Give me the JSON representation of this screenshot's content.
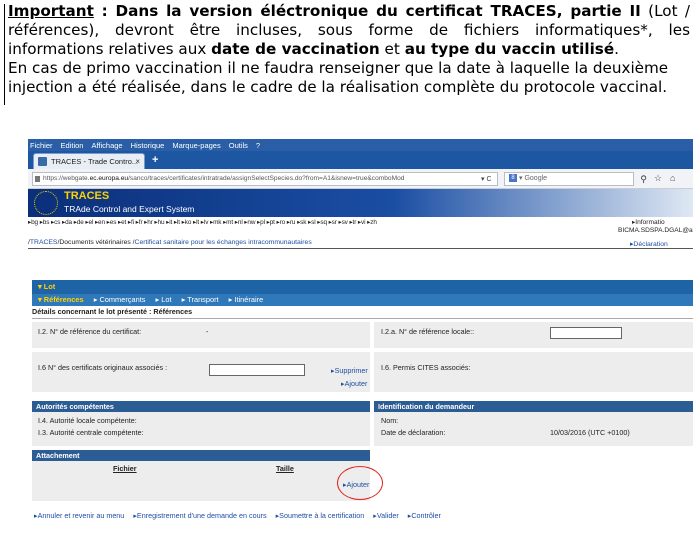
{
  "doc": {
    "important": "Important",
    "p1_bold": " : Dans la version éléctronique du certificat TRACES, partie II",
    "p1_text": " (Lot / références), devront être incluses, sous forme de fichiers informatiques*, les informations relatives aux ",
    "p1_bold2": "date de vaccination",
    "p1_text2": " et ",
    "p1_bold3": "au type du vaccin utilisé",
    "p1_end": ".",
    "p2": "En cas de primo vaccination il ne faudra renseigner que la date à laquelle la deuxième injection a été réalisée, dans le cadre de la réalisation complète du protocole vaccinal."
  },
  "browser": {
    "menu": [
      "Fichier",
      "Edition",
      "Affichage",
      "Historique",
      "Marque-pages",
      "Outils",
      "?"
    ],
    "tab_title": "TRACES - Trade Contro...",
    "url_prefix": "https://webgate.",
    "url_host": "ec.europa.eu",
    "url_rest": "/sanco/traces/certificates/intratrade/assignSelectSpecies.do?from=A1&isnew=true&comboMod",
    "search_placeholder": "Google"
  },
  "site": {
    "title": "TRACES",
    "subtitle": "TRAde Control and Expert System",
    "languages": "▸bg ▸bs ▸cs ▸da ▸de ▸el ▸en ▸es ▸et ▸fi ▸fr ▸hr ▸hu ▸it ▸lt ▸ko ▸lt ▸lv ▸mk ▸mt ▸nl ▸nw ▸pl ▸pt ▸ro ▸ru ▸sk ▸sl ▸sq ▸sr ▸sv ▸tr ▸vi ▸zh",
    "info": "▸Informatio",
    "user": "BICMA.SDSPA.DGAL@a",
    "breadcrumb_home": "TRACES",
    "breadcrumb_mid": "Documents vétérinaires",
    "breadcrumb_last": "Certificat sanitaire pour les échanges intracommunautaires",
    "declaration_link": "▸Déclaration"
  },
  "form": {
    "lot": "▾ Lot",
    "subnav": [
      "▾ Références",
      "▸ Commerçants",
      "▸ Lot",
      "▸ Transport",
      "▸ Itinéraire"
    ],
    "details_title": "Détails concernant le lot présenté : Références",
    "ref_cert_label": "I.2. N° de référence du certificat:",
    "ref_cert_value": "-",
    "ref_local_label": "I.2.a. N° de référence locale::",
    "orig_cert_label": "I.6 N° des certificats originaux associés :",
    "supprimer": "▸Supprimer",
    "ajouter": "▸Ajouter",
    "cites_label": "I.6. Permis CITES associés:",
    "autorites_title": "Autorités compétentes",
    "autorite_locale": "I.4. Autorité locale compétente:",
    "autorite_centrale": "I.3. Autorité centrale compétente:",
    "identification_title": "Identification du demandeur",
    "nom_label": "Nom:",
    "date_decl_label": "Date de déclaration:",
    "date_decl_value": "10/03/2016 (UTC +0100)",
    "attachement_title": "Attachement",
    "col_fichier": "Fichier",
    "col_taille": "Taille",
    "ajouter_attach": "▸Ajouter",
    "bottom": [
      "▸Annuler et revenir au menu",
      "▸Enregistrement d'une demande en cours",
      "▸Soumettre à la certification",
      "▸Valider",
      "▸Contrôler"
    ]
  }
}
